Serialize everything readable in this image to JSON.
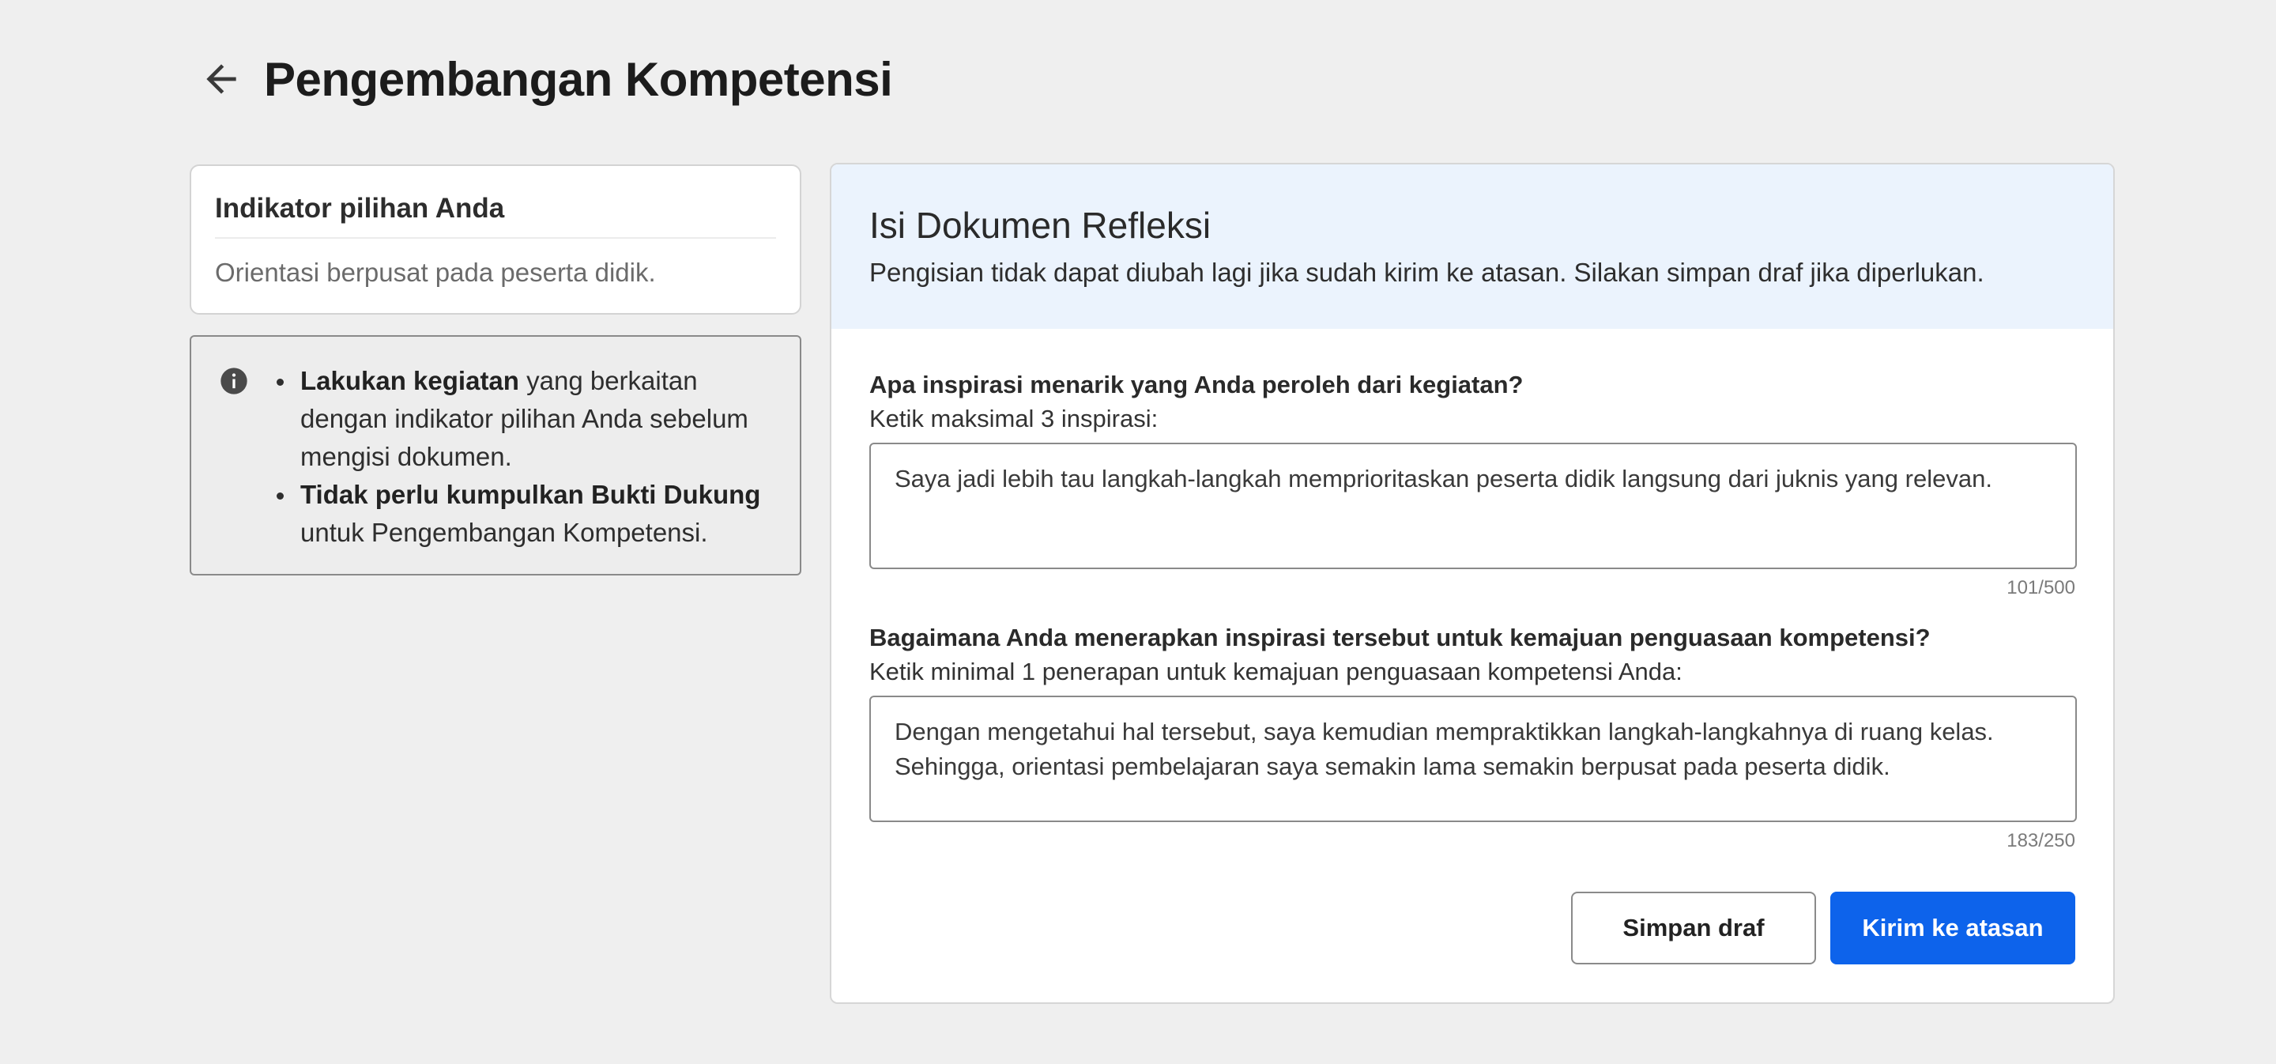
{
  "header": {
    "title": "Pengembangan Kompetensi",
    "back_icon": "arrow-left-icon"
  },
  "indicator": {
    "title": "Indikator pilihan Anda",
    "value": "Orientasi berpusat pada peserta didik."
  },
  "info": {
    "icon": "info-icon",
    "items": [
      {
        "bold": "Lakukan kegiatan",
        "text": " yang berkaitan dengan indikator pilihan Anda sebelum mengisi dokumen."
      },
      {
        "bold": "Tidak perlu kumpulkan Bukti Dukung",
        "text": " untuk Pengembangan Kompetensi."
      }
    ]
  },
  "document": {
    "title": "Isi Dokumen Refleksi",
    "subtitle": "Pengisian tidak dapat diubah lagi jika sudah kirim ke atasan. Silakan simpan draf jika diperlukan.",
    "questions": [
      {
        "label": "Apa inspirasi menarik yang Anda peroleh dari kegiatan?",
        "hint": "Ketik maksimal 3 inspirasi:",
        "answer": "Saya jadi lebih tau langkah-langkah memprioritaskan peserta didik langsung dari juknis yang relevan.",
        "counter": "101/500"
      },
      {
        "label": "Bagaimana Anda menerapkan inspirasi tersebut untuk kemajuan penguasaan kompetensi?",
        "hint": "Ketik minimal 1 penerapan untuk kemajuan penguasaan kompetensi Anda:",
        "answer": "Dengan mengetahui hal tersebut, saya kemudian mempraktikkan langkah-langkahnya di ruang kelas. Sehingga, orientasi pembelajaran saya semakin lama semakin berpusat pada peserta didik.",
        "counter": "183/250"
      }
    ]
  },
  "actions": {
    "save_label": "Simpan draf",
    "submit_label": "Kirim ke atasan"
  },
  "colors": {
    "primary": "#0d63eb",
    "background": "#efefef",
    "header_bg": "#ebf3fd"
  }
}
